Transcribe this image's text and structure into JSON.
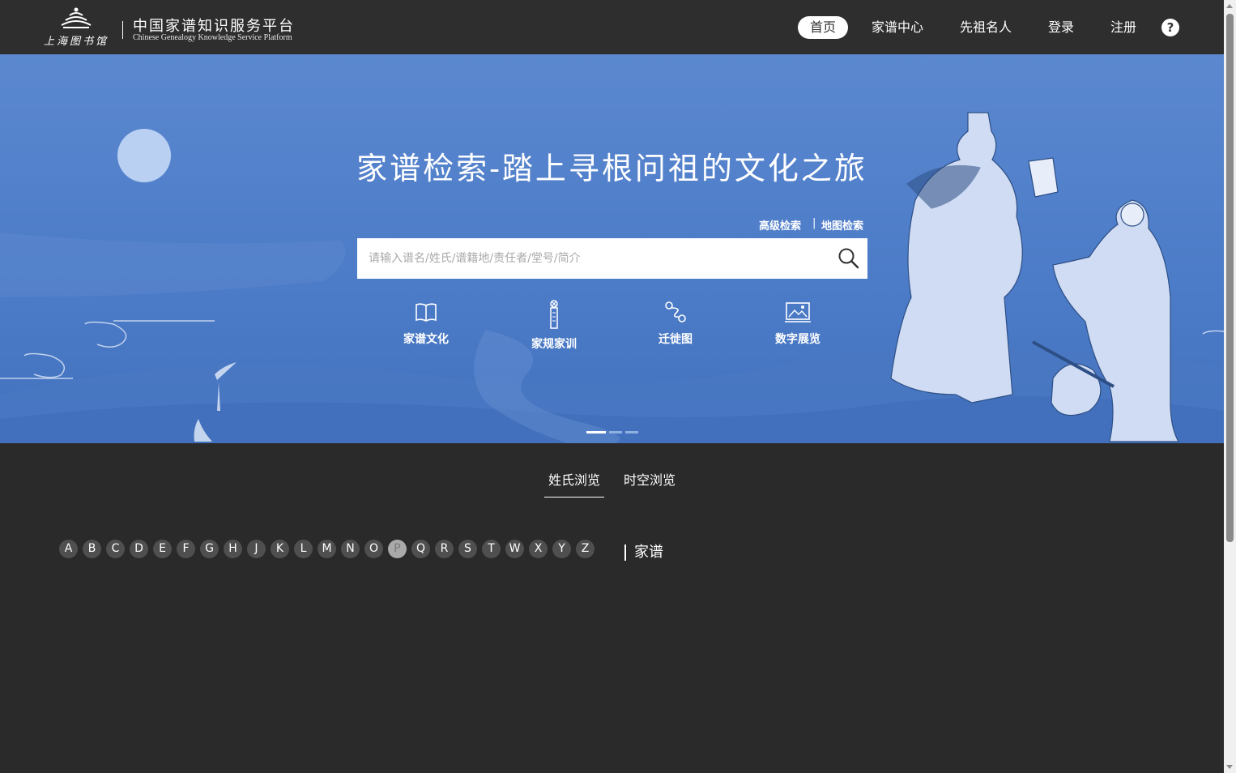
{
  "header": {
    "logo": {
      "library_name": "上海图书馆",
      "platform_name_cn": "中国家谱知识服务平台",
      "platform_name_en": "Chinese Genealogy Knowledge Service Platform"
    },
    "nav": [
      {
        "label": "首页",
        "active": true
      },
      {
        "label": "家谱中心"
      },
      {
        "label": "先祖名人"
      },
      {
        "label": "登录"
      },
      {
        "label": "注册"
      }
    ],
    "help_label": "?"
  },
  "banner": {
    "title": "家谱检索-踏上寻根问祖的文化之旅",
    "advanced_search": "高级检索",
    "separator": "|",
    "map_search": "地图检索",
    "search_placeholder": "请输入谱名/姓氏/谱籍地/责任者/堂号/简介",
    "search_value": "",
    "search_icon": "search-icon",
    "features": [
      {
        "label": "家谱文化",
        "icon": "open-book-icon"
      },
      {
        "label": "家规家训",
        "icon": "scroll-icon"
      },
      {
        "label": "迁徙图",
        "icon": "route-icon"
      },
      {
        "label": "数字展览",
        "icon": "picture-gallery-icon"
      }
    ],
    "carousel_active_index": 0,
    "carousel_count": 3
  },
  "browse": {
    "tabs": [
      {
        "label": "姓氏浏览",
        "active": true
      },
      {
        "label": "时空浏览"
      }
    ],
    "letters": [
      "A",
      "B",
      "C",
      "D",
      "E",
      "F",
      "G",
      "H",
      "J",
      "K",
      "L",
      "M",
      "N",
      "O",
      "P",
      "Q",
      "R",
      "S",
      "T",
      "W",
      "X",
      "Y",
      "Z"
    ],
    "selected_letter": "P",
    "result_title": "家谱"
  },
  "colors": {
    "header_bg": "#2e2e2e",
    "banner_blue": "#4d7cc8",
    "page_bg": "#2a2a2a",
    "letter_bg": "#4f4f4f",
    "letter_selected_bg": "#a9a9a9"
  }
}
